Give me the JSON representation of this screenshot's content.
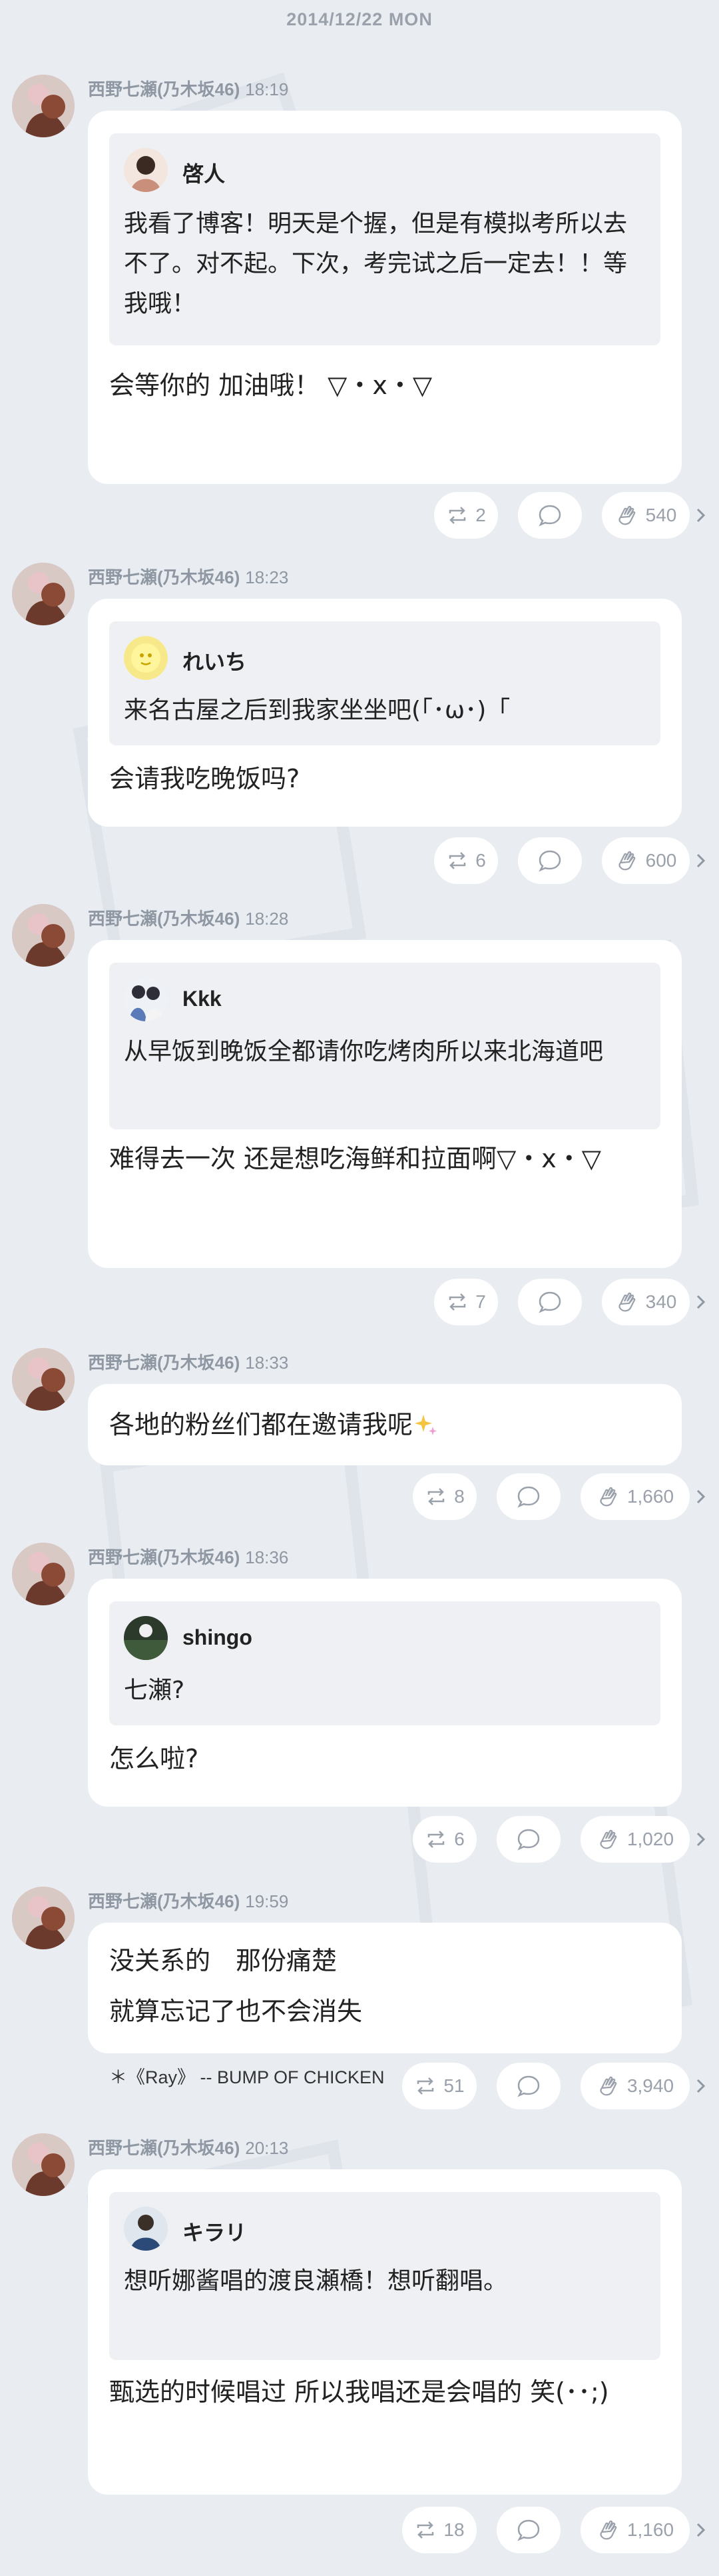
{
  "date_header": "2014/12/22 MON",
  "posts": [
    {
      "author": "西野七瀬(乃木坂46)",
      "time": "18:19",
      "quote_name": "啓人",
      "quote_text": "我看了博客！明天是个握，但是有模拟考所以去不了。对不起。下次，考完试之后一定去！！等我哦！",
      "reply": "会等你的 加油哦！ ▽・x・▽",
      "reposts": "2",
      "claps": "540"
    },
    {
      "author": "西野七瀬(乃木坂46)",
      "time": "18:23",
      "quote_name": "れいち",
      "quote_text": "来名古屋之后到我家坐坐吧(「･ω･)「",
      "reply": "会请我吃晚饭吗?",
      "reposts": "6",
      "claps": "600"
    },
    {
      "author": "西野七瀬(乃木坂46)",
      "time": "18:28",
      "quote_name": "Kkk",
      "quote_text": "从早饭到晚饭全都请你吃烤肉所以来北海道吧",
      "reply": "难得去一次 还是想吃海鲜和拉面啊▽・x・▽",
      "reposts": "7",
      "claps": "340"
    },
    {
      "author": "西野七瀬(乃木坂46)",
      "time": "18:33",
      "text": "各地的粉丝们都在邀请我呢",
      "reposts": "8",
      "claps": "1,660"
    },
    {
      "author": "西野七瀬(乃木坂46)",
      "time": "18:36",
      "quote_name": "shingo",
      "quote_text": "七瀬?",
      "reply": "怎么啦?",
      "reposts": "6",
      "claps": "1,020"
    },
    {
      "author": "西野七瀬(乃木坂46)",
      "time": "19:59",
      "text_lines": [
        "没关系的　那份痛楚",
        "就算忘记了也不会消失"
      ],
      "lyric": "＊《Ray》 -- BUMP OF CHICKEN",
      "reposts": "51",
      "claps": "3,940"
    },
    {
      "author": "西野七瀬(乃木坂46)",
      "time": "20:13",
      "quote_name": "キラリ",
      "quote_text": "想听娜酱唱的渡良瀬橋！想听翻唱。",
      "reply": "甄选的时候唱过 所以我唱还是会唱的 笑(･･;)",
      "reposts": "18",
      "claps": "1,160"
    }
  ],
  "icons": {
    "repost": "repost-icon",
    "comment": "comment-icon",
    "clap": "clap-icon",
    "more": "chevron-right-icon",
    "sparkle": "sparkle-icon"
  },
  "colors": {
    "background": "#e9edf2",
    "bubble": "#ffffff",
    "quote_bg": "#eef0f3",
    "meta": "#8f97a2",
    "icon": "#9aa1ab"
  }
}
